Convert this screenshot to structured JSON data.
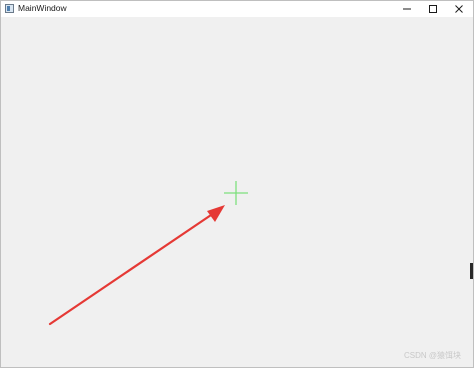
{
  "window": {
    "title": "MainWindow",
    "controls": [
      "minimize-icon",
      "maximize-icon",
      "close-icon"
    ]
  },
  "canvas": {
    "crosshair_color": "#7ee07e",
    "arrow_color": "#e53935"
  },
  "watermark": {
    "text": "CSDN @猿饵块"
  }
}
